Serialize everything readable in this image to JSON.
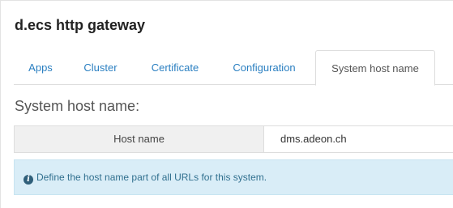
{
  "app": {
    "title": "d.ecs http gateway"
  },
  "tabs": [
    {
      "label": "Apps"
    },
    {
      "label": "Cluster"
    },
    {
      "label": "Certificate"
    },
    {
      "label": "Configuration"
    },
    {
      "label": "System host name",
      "active": true
    }
  ],
  "section": {
    "title": "System host name:",
    "field_label": "Host name",
    "field_value": "dms.adeon.ch"
  },
  "info": {
    "icon": "info-icon",
    "text": "Define the host name part of all URLs for this system."
  },
  "colors": {
    "link": "#2a7fc1",
    "info_bg": "#d9edf7",
    "info_text": "#31708f"
  }
}
